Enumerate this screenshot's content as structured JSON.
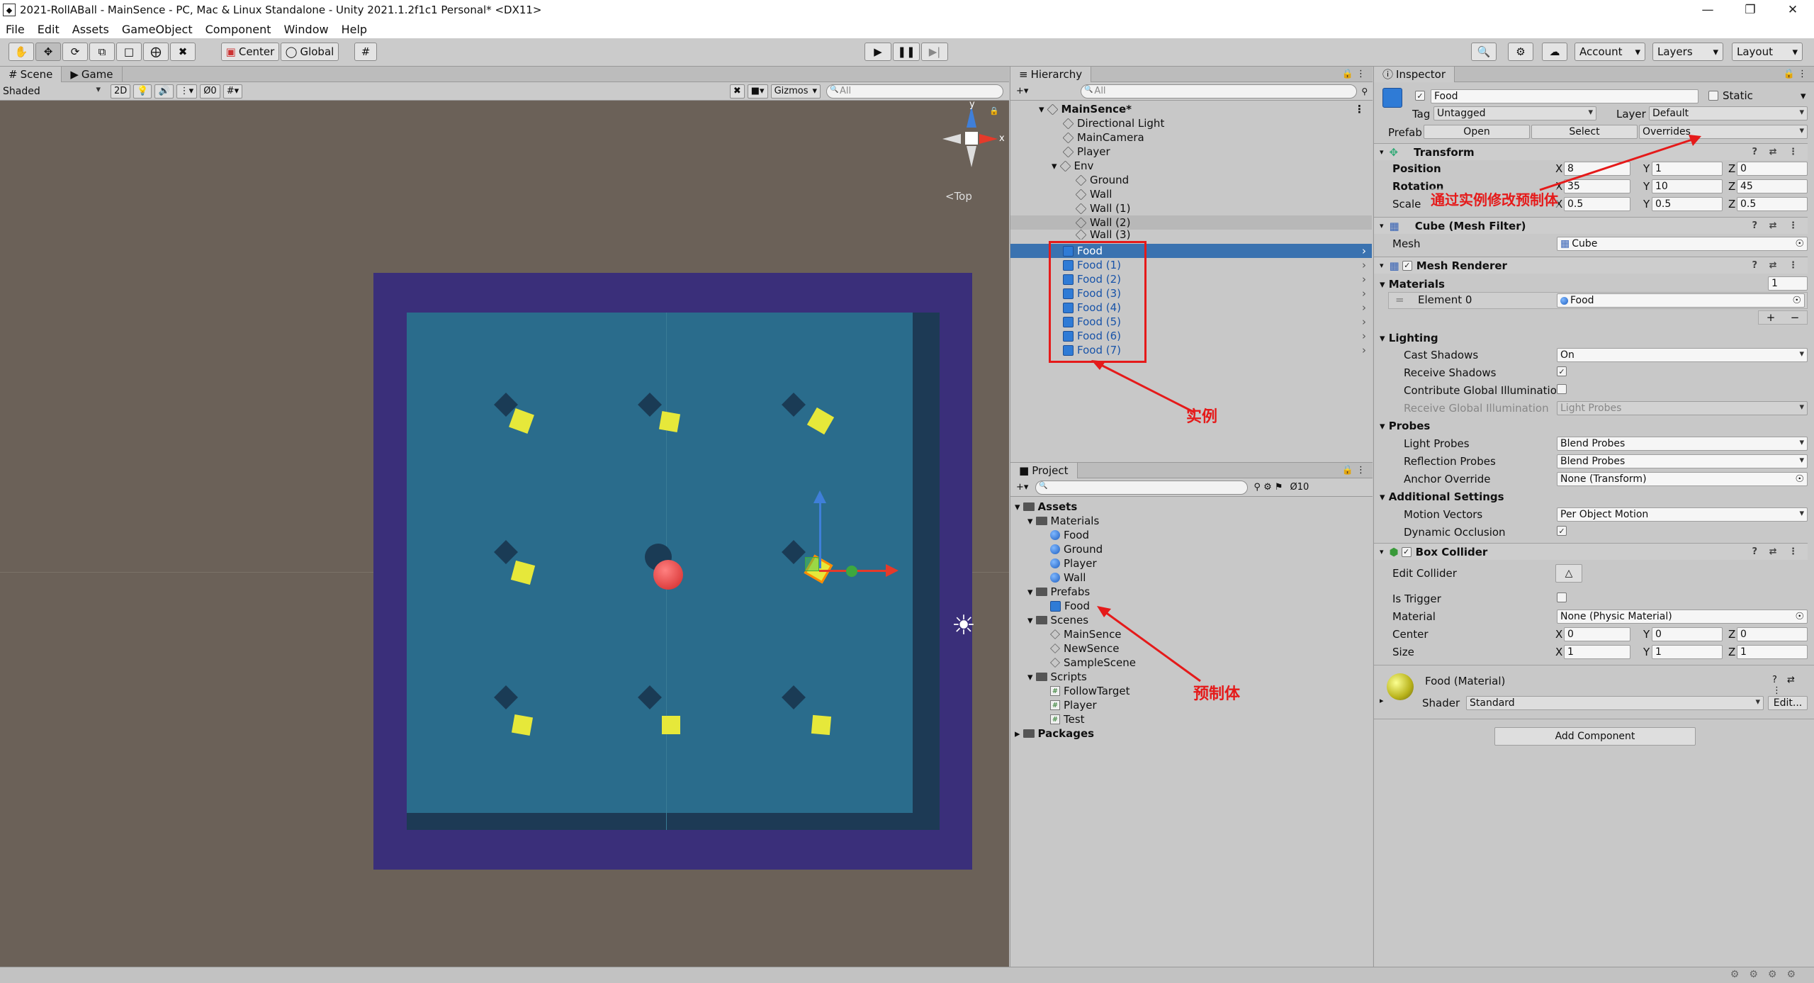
{
  "window": {
    "title": "2021-RollABall - MainSence - PC, Mac & Linux Standalone - Unity 2021.1.2f1c1 Personal* <DX11>",
    "minimize": "—",
    "maximize": "❐",
    "close": "✕"
  },
  "menu": [
    "File",
    "Edit",
    "Assets",
    "GameObject",
    "Component",
    "Window",
    "Help"
  ],
  "toolbar": {
    "center": "Center",
    "global": "Global",
    "account": "Account",
    "layers": "Layers",
    "layout": "Layout"
  },
  "scene": {
    "tab_scene": "Scene",
    "tab_game": "Game",
    "shaded": "Shaded",
    "mode2d": "2D",
    "fx_count": "0",
    "gizmos": "Gizmos",
    "search_placeholder": "All",
    "top_label": "<Top",
    "axis_x": "x",
    "axis_y": "y"
  },
  "hierarchy": {
    "title": "Hierarchy",
    "search_placeholder": "All",
    "scene_name": "MainSence*",
    "items": [
      {
        "label": "Directional Light",
        "depth": 1
      },
      {
        "label": "MainCamera",
        "depth": 1
      },
      {
        "label": "Player",
        "depth": 1
      },
      {
        "label": "Env",
        "depth": 1
      },
      {
        "label": "Ground",
        "depth": 2
      },
      {
        "label": "Wall",
        "depth": 2
      },
      {
        "label": "Wall (1)",
        "depth": 2
      },
      {
        "label": "Wall (2)",
        "depth": 2
      },
      {
        "label": "Wall (3)",
        "depth": 2
      },
      {
        "label": "Food",
        "depth": 1
      },
      {
        "label": "Food (1)",
        "depth": 1
      },
      {
        "label": "Food (2)",
        "depth": 1
      },
      {
        "label": "Food (3)",
        "depth": 1
      },
      {
        "label": "Food (4)",
        "depth": 1
      },
      {
        "label": "Food (5)",
        "depth": 1
      },
      {
        "label": "Food (6)",
        "depth": 1
      },
      {
        "label": "Food (7)",
        "depth": 1
      }
    ],
    "annotation": "实例"
  },
  "project": {
    "title": "Project",
    "count": "10",
    "assets": "Assets",
    "materials": "Materials",
    "mat_items": [
      "Food",
      "Ground",
      "Player",
      "Wall"
    ],
    "prefabs": "Prefabs",
    "prefab_items": [
      "Food"
    ],
    "scenes": "Scenes",
    "scene_items": [
      "MainSence",
      "NewSence",
      "SampleScene"
    ],
    "scripts": "Scripts",
    "script_items": [
      "FollowTarget",
      "Player",
      "Test"
    ],
    "packages": "Packages",
    "annotation": "预制体"
  },
  "inspector": {
    "title": "Inspector",
    "name": "Food",
    "static": "Static",
    "tag_label": "Tag",
    "tag": "Untagged",
    "layer_label": "Layer",
    "layer": "Default",
    "prefab_label": "Prefab",
    "open": "Open",
    "select": "Select",
    "overrides": "Overrides",
    "transform": {
      "title": "Transform",
      "position": "Position",
      "rotation": "Rotation",
      "scale": "Scale",
      "px": "8",
      "py": "1",
      "pz": "0",
      "rx": "35",
      "ry": "10",
      "rz": "45",
      "sx": "0.5",
      "sy": "0.5",
      "sz": "0.5"
    },
    "annotation": "通过实例修改预制体",
    "meshfilter": {
      "title": "Cube (Mesh Filter)",
      "mesh_label": "Mesh",
      "mesh": "Cube"
    },
    "renderer": {
      "title": "Mesh Renderer",
      "materials": "Materials",
      "mat_count": "1",
      "element0": "Element 0",
      "element0_val": "Food",
      "lighting": "Lighting",
      "cast_shadows": "Cast Shadows",
      "cast_val": "On",
      "receive_shadows": "Receive Shadows",
      "contribute_gi": "Contribute Global Illuminatior",
      "receive_gi": "Receive Global Illumination",
      "receive_gi_val": "Light Probes",
      "probes": "Probes",
      "light_probes": "Light Probes",
      "light_probes_val": "Blend Probes",
      "reflection_probes": "Reflection Probes",
      "reflection_val": "Blend Probes",
      "anchor_override": "Anchor Override",
      "anchor_val": "None (Transform)",
      "additional": "Additional Settings",
      "motion_vectors": "Motion Vectors",
      "motion_val": "Per Object Motion",
      "dynamic_occlusion": "Dynamic Occlusion"
    },
    "boxcollider": {
      "title": "Box Collider",
      "edit_collider": "Edit Collider",
      "is_trigger": "Is Trigger",
      "material_label": "Material",
      "material": "None (Physic Material)",
      "center": "Center",
      "cx": "0",
      "cy": "0",
      "cz": "0",
      "size": "Size",
      "sx": "1",
      "sy": "1",
      "sz": "1"
    },
    "material": {
      "title": "Food (Material)",
      "shader_label": "Shader",
      "shader": "Standard",
      "edit": "Edit..."
    },
    "add_component": "Add Component"
  },
  "colors": {
    "accent": "#3a72b0",
    "annotation": "#e51a1a",
    "scene_bg": "#6b6158",
    "wall": "#3a2f7a",
    "floor": "#2a6c8c"
  }
}
